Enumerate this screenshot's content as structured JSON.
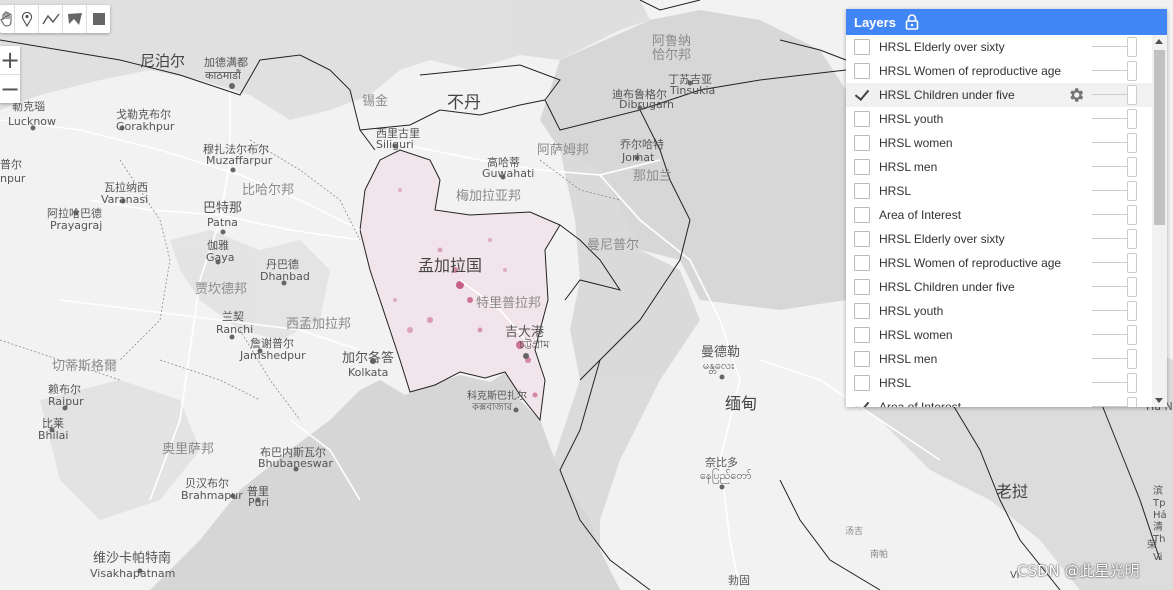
{
  "toolbar": {
    "tools": [
      {
        "name": "pan",
        "icon": "hand-icon"
      },
      {
        "name": "marker",
        "icon": "marker-icon"
      },
      {
        "name": "line",
        "icon": "line-icon"
      },
      {
        "name": "polygon",
        "icon": "polygon-icon"
      },
      {
        "name": "rectangle",
        "icon": "rectangle-icon"
      }
    ]
  },
  "zoom": {
    "in_label": "+",
    "out_label": "−"
  },
  "layers_panel": {
    "title": "Layers",
    "icon": "lock-icon",
    "items": [
      {
        "label": "HRSL Elderly over sixty",
        "checked": false
      },
      {
        "label": "HRSL Women of reproductive age",
        "checked": false
      },
      {
        "label": "HRSL Children under five",
        "checked": true,
        "show_settings": true
      },
      {
        "label": "HRSL youth",
        "checked": false
      },
      {
        "label": "HRSL women",
        "checked": false
      },
      {
        "label": "HRSL men",
        "checked": false
      },
      {
        "label": "HRSL",
        "checked": false
      },
      {
        "label": "Area of Interest",
        "checked": false
      },
      {
        "label": "HRSL Elderly over sixty",
        "checked": false
      },
      {
        "label": "HRSL Women of reproductive age",
        "checked": false
      },
      {
        "label": "HRSL Children under five",
        "checked": false
      },
      {
        "label": "HRSL youth",
        "checked": false
      },
      {
        "label": "HRSL women",
        "checked": false
      },
      {
        "label": "HRSL men",
        "checked": false
      },
      {
        "label": "HRSL",
        "checked": false
      },
      {
        "label": "Area of Interest",
        "checked": true
      }
    ]
  },
  "map_labels": {
    "nepal": "尼泊尔",
    "kathmandu_zh": "加德满都",
    "kathmandu_local": "काठमाडौं",
    "lucknow_zh": "勒克瑙",
    "lucknow": "Lucknow",
    "gorakhpur_zh": "戈勒克布尔",
    "gorakhpur": "Gorakhpur",
    "muzaffarpur_zh": "穆扎法尔布尔",
    "muzaffarpur": "Muzaffarpur",
    "kanpur_zh": "普尔",
    "kanpur": "npur",
    "varanasi_zh": "瓦拉纳西",
    "varanasi": "Varanasi",
    "prayagraj_zh": "阿拉哈巴德",
    "prayagraj": "Prayagraj",
    "patna_zh": "巴特那",
    "patna": "Patna",
    "bihar": "比哈尔邦",
    "gaya_zh": "伽雅",
    "gaya": "Gaya",
    "dhanbad_zh": "丹巴德",
    "dhanbad": "Dhanbad",
    "jharkhand": "贾坎德邦",
    "ranchi_zh": "兰契",
    "ranchi": "Ranchi",
    "jamshedpur_zh": "詹谢普尔",
    "jamshedpur": "Jamshedpur",
    "west_bengal": "西孟加拉邦",
    "chhattisgarh": "切蒂斯格爾",
    "raipur_zh": "赖布尔",
    "raipur": "Raipur",
    "bhilai_zh": "比莱",
    "bhilai": "Bhilai",
    "odisha": "奥里萨邦",
    "bhubaneswar_zh": "布巴内斯瓦尔",
    "bhubaneswar": "Bhubaneswar",
    "brahmapur_zh": "贝汉布尔",
    "brahmapur": "Brahmapur",
    "puri_zh": "普里",
    "puri": "Puri",
    "visakhapatnam_zh": "维沙卡帕特南",
    "visakhapatnam": "Visakhapatnam",
    "kolkata_zh": "加尔各答",
    "kolkata": "Kolkata",
    "sikkim": "锡金",
    "siliguri_zh": "西里古里",
    "siliguri": "Siliguri",
    "bhutan": "不丹",
    "guwahati_zh": "高哈蒂",
    "guwahati": "Guwahati",
    "assam": "阿萨姆邦",
    "meghalaya": "梅加拉亚邦",
    "arunachal": "阿鲁纳",
    "arunachal2": "恰尔邦",
    "tinsukia_zh": "丁苏吉亚",
    "tinsukia": "Tinsukia",
    "dibrugarh_zh": "迪布鲁格尔",
    "dibrugarh": "Dibrugarh",
    "jorhat_zh": "乔尔哈特",
    "jorhat": "Jorhat",
    "nagaland": "那加兰",
    "manipur": "曼尼普尔",
    "bangladesh": "孟加拉国",
    "tripura": "特里普拉邦",
    "chittagong": "吉大港",
    "chittagong_local": "চট্টগ্রাম",
    "coxs_bazar_zh": "科克斯巴扎尔",
    "coxs_bazar_local": "কক্সবাজার",
    "mandalay_zh": "曼德勒",
    "mandalay_local": "မန္တလေး",
    "myanmar": "缅甸",
    "naypyidaw_zh": "奈比多",
    "naypyidaw_local": "နေပြည်တော်",
    "laos": "老挝",
    "hanoi_partial": "Ha N",
    "nanpa": "南帕",
    "tangjie": "汤吉",
    "bogo": "勃固",
    "right_edge1": "滨",
    "right_edge2": "Tp",
    "right_edge3": "Hả",
    "right_edge4": "清",
    "right_edge5": "Th",
    "right_edge6": "荣",
    "right_edge7": "Vi",
    "right_edge8": "Vi"
  },
  "watermark": "CSDN @此星光明",
  "colors": {
    "header_blue": "#4285f4",
    "map_land": "#f2f2f2",
    "map_water": "#d6d6d6",
    "terrain": "#dcdcdc",
    "population_overlay": "#b32a5a"
  }
}
